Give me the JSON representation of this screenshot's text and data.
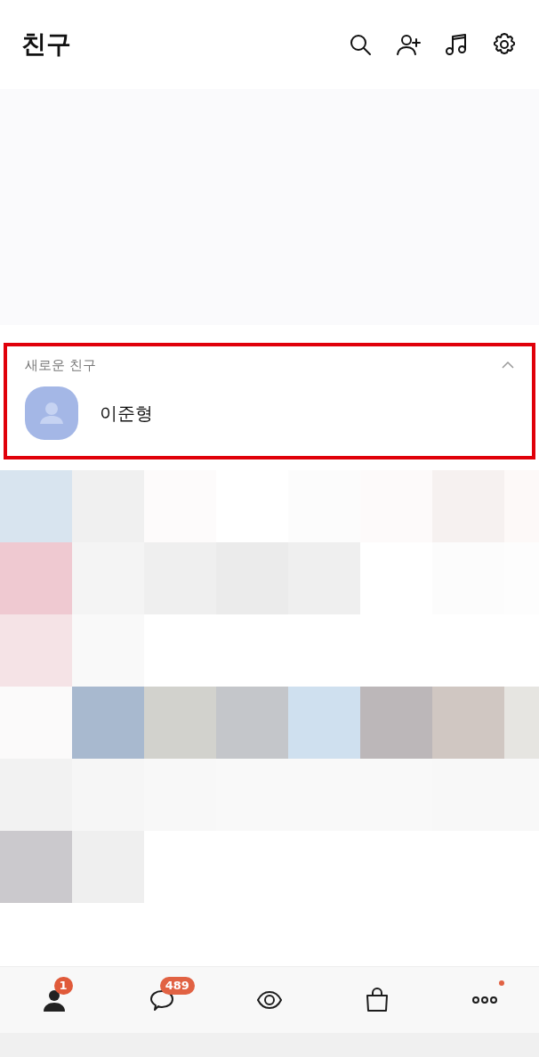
{
  "header": {
    "title": "친구"
  },
  "new_friends": {
    "title": "새로운 친구",
    "expanded": true,
    "friends": [
      {
        "name": "이준형"
      }
    ]
  },
  "tabs": [
    {
      "kind": "friends",
      "selected": true,
      "badge": "1",
      "dot": false
    },
    {
      "kind": "chats",
      "selected": false,
      "badge": "489",
      "dot": false
    },
    {
      "kind": "view",
      "selected": false,
      "dot": false
    },
    {
      "kind": "shopping",
      "selected": false,
      "dot": false
    },
    {
      "kind": "more",
      "selected": false,
      "dot": true
    }
  ]
}
